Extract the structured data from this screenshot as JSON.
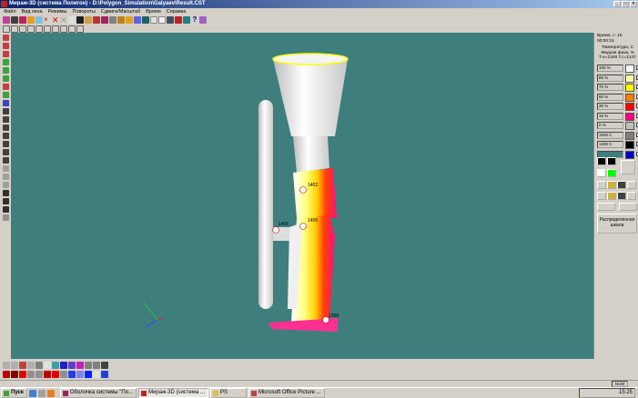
{
  "window": {
    "title": "Мираж-3D (система Полигон) - D:\\Polygon_Simulation\\Galyaev\\Result.CST",
    "controls": [
      "_",
      "□",
      "×"
    ]
  },
  "menu": [
    "Файл",
    "Вид окна",
    "Режимы",
    "Повороты",
    "Сдвиги/Масштаб",
    "Время",
    "Справка"
  ],
  "panel": {
    "time_label": "Время, с: 15",
    "time_value": "00:00:15",
    "field_title": "Температура, С",
    "field_sub": "Жидкая фаза, %",
    "range": "T.н=1346 T.с=1147",
    "legend": [
      {
        "label": "100 %",
        "color": "#ffffff"
      },
      {
        "label": "85 %",
        "color": "#ffffa8"
      },
      {
        "label": "70 %",
        "color": "#ffff00"
      },
      {
        "label": "50 %",
        "color": "#ff8000"
      },
      {
        "label": "30 %",
        "color": "#ff0000"
      },
      {
        "label": "15 %",
        "color": "#ff0080"
      },
      {
        "label": "0 %",
        "color": "#c0c0c0"
      },
      {
        "label": "1500 C",
        "color": "#808080"
      },
      {
        "label": "1200 C",
        "color": "#000000"
      },
      {
        "label": "",
        "color": "#0000c0"
      }
    ],
    "distribution_button": "Распределенная шкала"
  },
  "model": {
    "probes": [
      "1402",
      "1405",
      "1406",
      "1308"
    ]
  },
  "status": {
    "num": "NUM"
  },
  "taskbar": {
    "start": "Пуск",
    "tasks": [
      "Оболочка системы \"По...",
      "Мираж-3D (система ...",
      "PS",
      "Microsoft Office Picture ..."
    ],
    "clock": "15:25"
  }
}
